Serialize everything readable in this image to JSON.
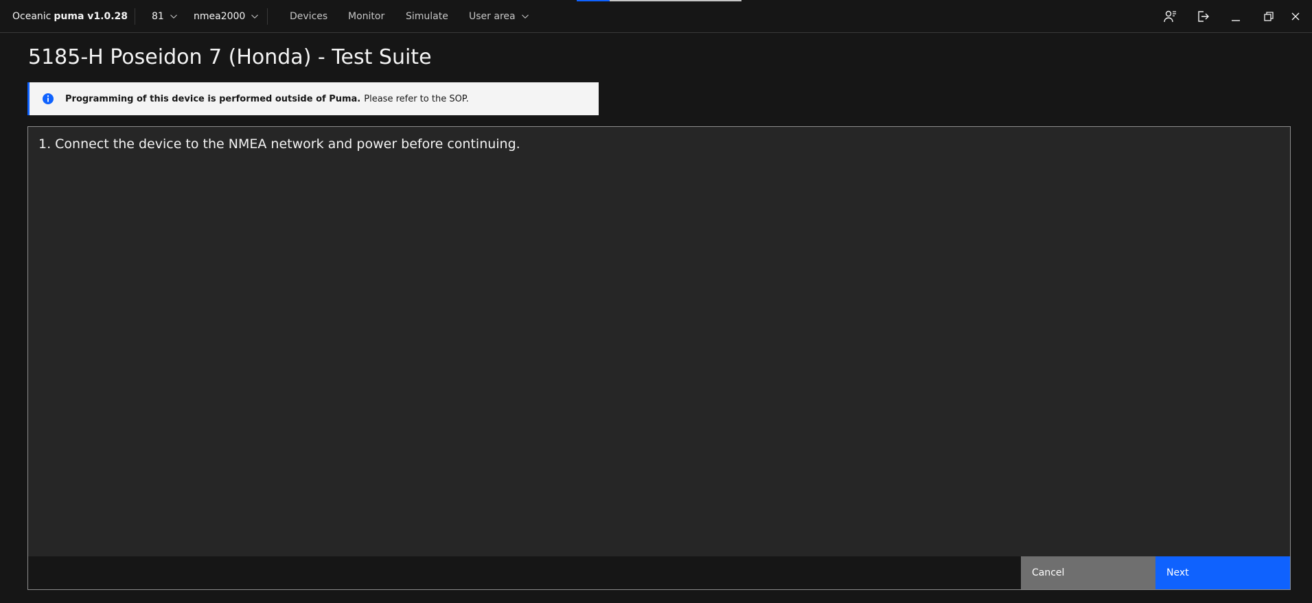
{
  "app": {
    "brand_prefix": "Oceanic",
    "brand_name": "puma v1.0.28"
  },
  "header": {
    "selector_number": "81",
    "selector_protocol": "nmea2000",
    "nav": [
      "Devices",
      "Monitor",
      "Simulate",
      "User area"
    ],
    "icons": {
      "user_menu": "user-list-icon",
      "logout": "logout-icon",
      "minimize": "minimize-icon",
      "restore": "restore-icon",
      "close": "close-icon"
    }
  },
  "page": {
    "title": "5185-H Poseidon 7 (Honda) - Test Suite"
  },
  "notification": {
    "title": "Programming of this device is performed outside of Puma.",
    "subtitle": "Please refer to the SOP.",
    "icon": "info-icon"
  },
  "step": {
    "text": "1. Connect the device to the NMEA network and power before continuing."
  },
  "actions": {
    "cancel_label": "Cancel",
    "next_label": "Next"
  },
  "colors": {
    "background": "#161616",
    "panel": "#262626",
    "accent": "#0f62fe",
    "secondary_button": "#6f6f6f",
    "notification_bg": "#f4f4f4"
  }
}
